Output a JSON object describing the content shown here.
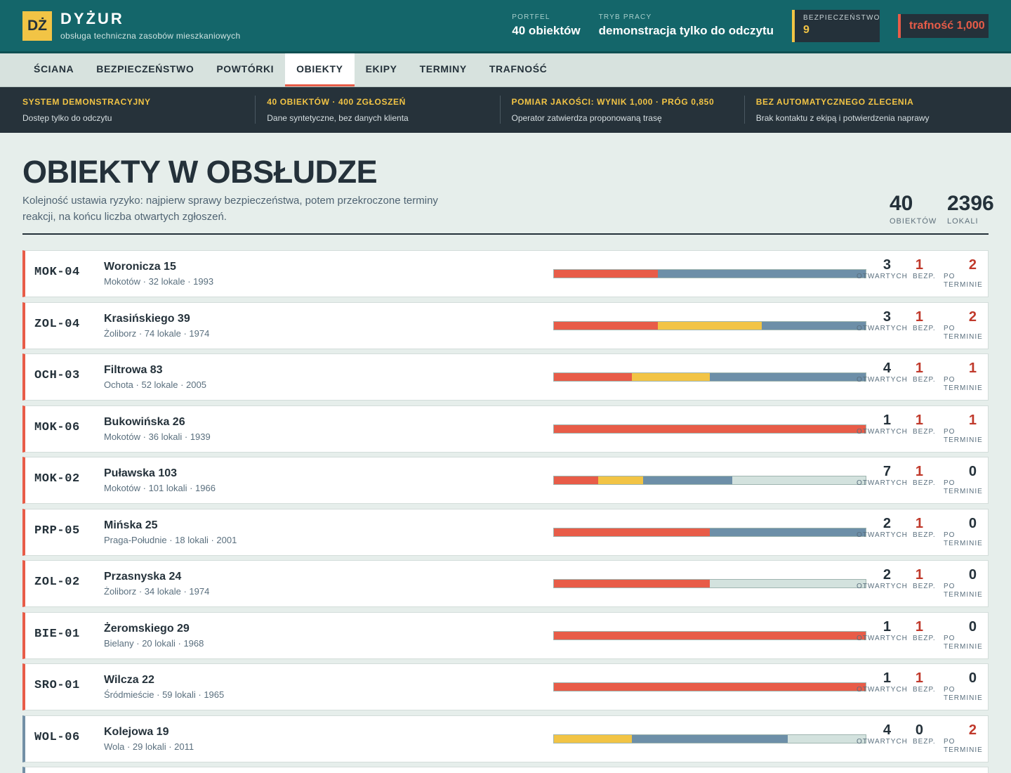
{
  "brand": {
    "logo": "DŻ",
    "name": "DYŻUR",
    "subtitle": "obsługa techniczna zasobów mieszkaniowych"
  },
  "header": {
    "portfolio_label": "PORTFEL",
    "portfolio_value": "40 obiektów",
    "mode_label": "TRYB PRACY",
    "mode_value": "demonstracja tylko do odczytu",
    "safety_label": "BEZPIECZEŃSTWO",
    "safety_value": "9",
    "accuracy": "trafność 1,000"
  },
  "nav": {
    "items": [
      "ŚCIANA",
      "BEZPIECZEŃSTWO",
      "POWTÓRKI",
      "OBIEKTY",
      "EKIPY",
      "TERMINY",
      "TRAFNOŚĆ"
    ],
    "active": "OBIEKTY"
  },
  "strip": [
    {
      "title": "SYSTEM DEMONSTRACYJNY",
      "desc": "Dostęp tylko do odczytu"
    },
    {
      "title": "40 OBIEKTÓW · 400 ZGŁOSZEŃ",
      "desc": "Dane syntetyczne, bez danych klienta"
    },
    {
      "title": "POMIAR JAKOŚCI: WYNIK 1,000 · PRÓG 0,850",
      "desc": "Operator zatwierdza proponowaną trasę"
    },
    {
      "title": "BEZ AUTOMATYCZNEGO ZLECENIA",
      "desc": "Brak kontaktu z ekipą i potwierdzenia naprawy"
    }
  ],
  "page": {
    "title": "OBIEKTY W OBSŁUDZE",
    "description": "Kolejność ustawia ryzyko: najpierw sprawy bezpieczeństwa, potem przekroczone terminy reakcji, na końcu liczba otwartych zgłoszeń.",
    "stats": [
      {
        "value": "40",
        "label": "OBIEKTÓW"
      },
      {
        "value": "2396",
        "label": "LOKALI"
      }
    ]
  },
  "labels": {
    "open": "OTWARTYCH",
    "safety": "BEZP.",
    "overdue_1": "PO",
    "overdue_2": "TERMINIE"
  },
  "colors": {
    "red": "#e85c48",
    "yellow": "#f2c445",
    "blue": "#6d8fa8",
    "teal": "#14666a"
  },
  "buildings": [
    {
      "code": "MOK-04",
      "address": "Woronicza 15",
      "meta": "Mokotów · 32 lokale · 1993",
      "open": 3,
      "safety": 1,
      "overdue": 2,
      "segments": [
        [
          "red",
          1
        ],
        [
          "blu",
          2
        ]
      ]
    },
    {
      "code": "ZOL-04",
      "address": "Krasińskiego 39",
      "meta": "Żoliborz · 74 lokale · 1974",
      "open": 3,
      "safety": 1,
      "overdue": 2,
      "segments": [
        [
          "red",
          1
        ],
        [
          "yel",
          1
        ],
        [
          "blu",
          1
        ]
      ]
    },
    {
      "code": "OCH-03",
      "address": "Filtrowa 83",
      "meta": "Ochota · 52 lokale · 2005",
      "open": 4,
      "safety": 1,
      "overdue": 1,
      "segments": [
        [
          "red",
          1
        ],
        [
          "yel",
          1
        ],
        [
          "blu",
          2
        ]
      ]
    },
    {
      "code": "MOK-06",
      "address": "Bukowińska 26",
      "meta": "Mokotów · 36 lokali · 1939",
      "open": 1,
      "safety": 1,
      "overdue": 1,
      "segments": [
        [
          "red",
          1
        ]
      ]
    },
    {
      "code": "MOK-02",
      "address": "Puławska 103",
      "meta": "Mokotów · 101 lokali · 1966",
      "open": 7,
      "safety": 1,
      "overdue": 0,
      "segments": [
        [
          "red",
          1
        ],
        [
          "yel",
          1
        ],
        [
          "blu",
          2
        ],
        [
          "none",
          3
        ]
      ]
    },
    {
      "code": "PRP-05",
      "address": "Mińska 25",
      "meta": "Praga-Południe · 18 lokali · 2001",
      "open": 2,
      "safety": 1,
      "overdue": 0,
      "segments": [
        [
          "red",
          1
        ],
        [
          "blu",
          1
        ]
      ]
    },
    {
      "code": "ZOL-02",
      "address": "Przasnyska 24",
      "meta": "Żoliborz · 34 lokale · 1974",
      "open": 2,
      "safety": 1,
      "overdue": 0,
      "segments": [
        [
          "red",
          1
        ],
        [
          "none",
          1
        ]
      ]
    },
    {
      "code": "BIE-01",
      "address": "Żeromskiego 29",
      "meta": "Bielany · 20 lokali · 1968",
      "open": 1,
      "safety": 1,
      "overdue": 0,
      "segments": [
        [
          "red",
          1
        ]
      ]
    },
    {
      "code": "SRO-01",
      "address": "Wilcza 22",
      "meta": "Śródmieście · 59 lokali · 1965",
      "open": 1,
      "safety": 1,
      "overdue": 0,
      "segments": [
        [
          "red",
          1
        ]
      ]
    },
    {
      "code": "WOL-06",
      "address": "Kolejowa 19",
      "meta": "Wola · 29 lokali · 2011",
      "open": 4,
      "safety": 0,
      "overdue": 2,
      "segments": [
        [
          "yel",
          1
        ],
        [
          "blu",
          2
        ],
        [
          "none",
          1
        ]
      ]
    }
  ]
}
